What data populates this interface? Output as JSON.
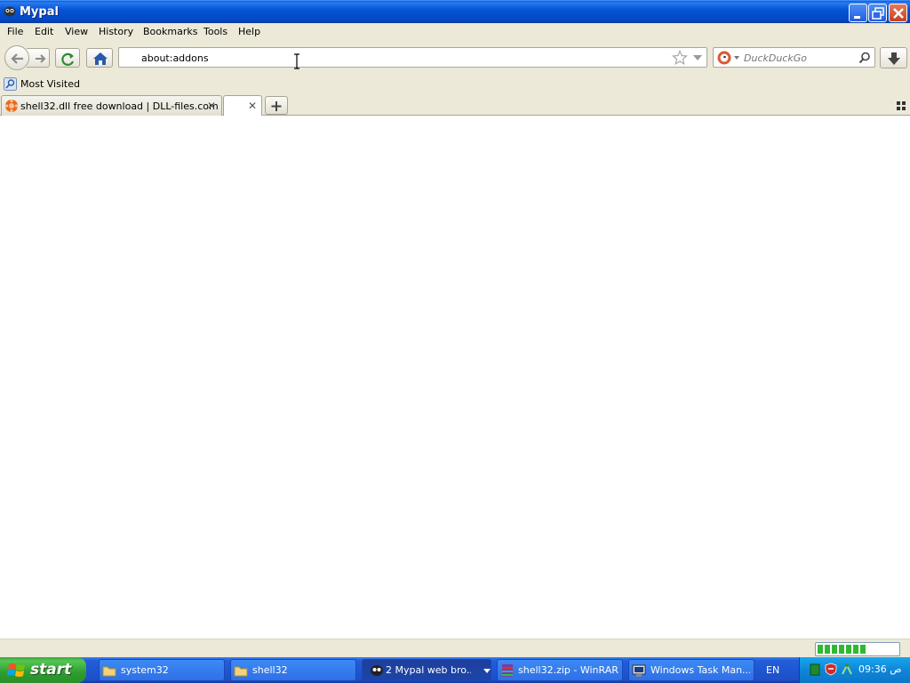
{
  "window": {
    "title": "Mypal"
  },
  "menu": [
    "File",
    "Edit",
    "View",
    "History",
    "Bookmarks",
    "Tools",
    "Help"
  ],
  "toolbar": {
    "url": "about:addons",
    "search_placeholder": "DuckDuckGo"
  },
  "bookmarks": {
    "most_visited": "Most Visited"
  },
  "tabs": [
    {
      "label": "shell32.dll free download | DLL-files.com"
    },
    {
      "label": ""
    }
  ],
  "status": {
    "progress_fraction": 0.6
  },
  "taskbar": {
    "start": "start",
    "tasks": [
      {
        "label": "system32"
      },
      {
        "label": "shell32"
      },
      {
        "label": "2 Mypal web bro..."
      },
      {
        "label": "shell32.zip - WinRAR"
      },
      {
        "label": "Windows Task Man..."
      }
    ],
    "language": "EN",
    "clock": "09:36 ص"
  },
  "colors": {
    "xp_blue": "#245edb",
    "start_green": "#3fa43f",
    "chrome_bg": "#ece9d8"
  }
}
